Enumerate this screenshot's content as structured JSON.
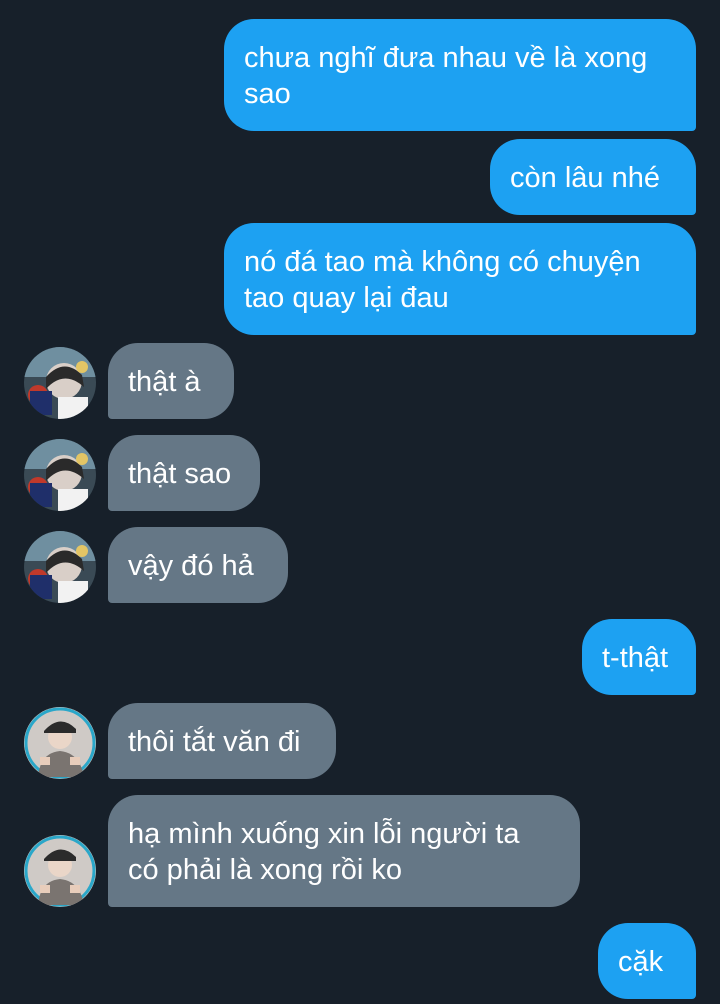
{
  "messages": [
    {
      "side": "out",
      "text": "chưa nghĩ đưa nhau về là xong\nsao"
    },
    {
      "side": "out",
      "text": "còn lâu nhé"
    },
    {
      "side": "out",
      "text": "nó đá tao mà không có chuyện\ntao quay lại đau"
    },
    {
      "side": "in",
      "avatar": "anime-character-avatar",
      "text": "thật à"
    },
    {
      "side": "in",
      "avatar": "anime-character-avatar",
      "text": "thật sao"
    },
    {
      "side": "in",
      "avatar": "anime-character-avatar",
      "text": "vậy đó hả"
    },
    {
      "side": "out",
      "text": "t-thật"
    },
    {
      "side": "in",
      "avatar": "person-in-cap-avatar",
      "text": "thôi tắt văn đi"
    },
    {
      "side": "in",
      "avatar": "person-in-cap-avatar",
      "text": "hạ mình xuống xin lỗi người ta\ncó phải là xong rồi ko"
    },
    {
      "side": "out",
      "text": "cặk"
    }
  ],
  "colors": {
    "background": "#17202a",
    "outgoing_bubble": "#1da1f2",
    "incoming_bubble": "#657786",
    "text": "#ffffff"
  }
}
